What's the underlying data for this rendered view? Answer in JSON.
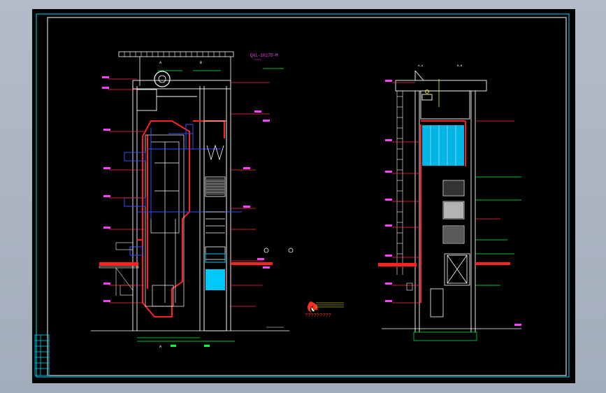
{
  "window": {
    "background": "#a9b4c2",
    "canvas_background": "#000000"
  },
  "colors": {
    "frame": "#00d8ff",
    "wall": "#ffffff",
    "hot": "#ff2020",
    "duct": "#3050ff",
    "dim": "#ff40ff",
    "leader": "#ff3040",
    "level": "#00ff40",
    "cyan_fill": "#00c8ff",
    "yellow": "#ffff00"
  },
  "drawing": {
    "left_view": {
      "title": "QXL-10275-M",
      "subtitle": "????",
      "section_a": "A",
      "section_b": "B",
      "bottom_mark": "A"
    },
    "right_view": {
      "section_label_left": "A-A",
      "section_label_right": "B-B"
    },
    "logo_caption": "?????????",
    "logo_icon": "flame-logo-icon"
  }
}
